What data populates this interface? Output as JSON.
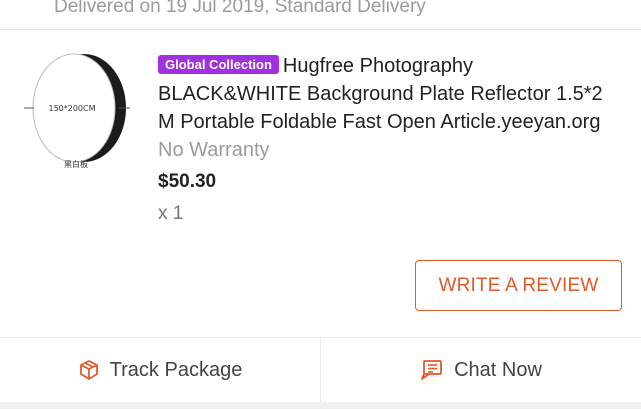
{
  "delivery": {
    "text": "Delivered on 19 Jul 2019, Standard Delivery"
  },
  "product": {
    "image_text": "150*200CM",
    "image_caption": "黑白板",
    "badge": "Global Collection",
    "title": "Hugfree Photography BLACK&WHITE Background Plate Reflector 1.5*2 M Portable Foldable Fast Open Article.yeeyan.org",
    "warranty": "No Warranty",
    "price": "$50.30",
    "quantity": "x 1"
  },
  "actions": {
    "review": "WRITE A REVIEW"
  },
  "bottom_bar": {
    "track": "Track Package",
    "chat": "Chat Now"
  },
  "colors": {
    "accent": "#e05a2a",
    "badge": "#a030e0"
  }
}
